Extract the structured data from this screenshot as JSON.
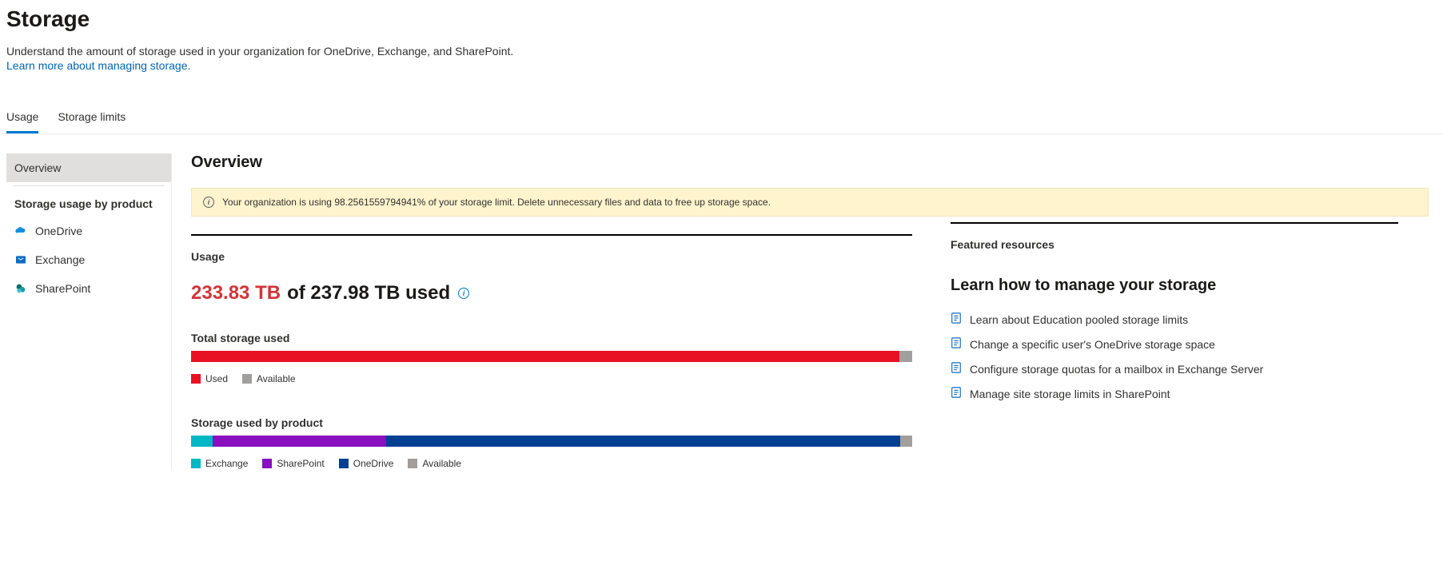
{
  "header": {
    "title": "Storage",
    "description": "Understand the amount of storage used in your organization for OneDrive, Exchange, and SharePoint.",
    "link": "Learn more about managing storage."
  },
  "tabs": {
    "items": [
      "Usage",
      "Storage limits"
    ],
    "active": 0
  },
  "sidebar": {
    "overview": "Overview",
    "section_heading": "Storage usage by product",
    "items": [
      {
        "label": "OneDrive",
        "icon": "onedrive"
      },
      {
        "label": "Exchange",
        "icon": "exchange"
      },
      {
        "label": "SharePoint",
        "icon": "sharepoint"
      }
    ]
  },
  "overview": {
    "heading": "Overview",
    "banner": "Your organization is using 98.2561559794941% of your storage limit. Delete unnecessary files and data to free up storage space.",
    "usage_heading": "Usage",
    "usage_used": "233.83 TB",
    "usage_rest": "of 237.98 TB used",
    "chart1_label": "Total storage used",
    "chart2_label": "Storage used by product"
  },
  "chart_data": [
    {
      "type": "bar",
      "title": "Total storage used",
      "series": [
        {
          "name": "Used",
          "values": [
            98.26
          ],
          "color": "#e81123"
        },
        {
          "name": "Available",
          "values": [
            1.74
          ],
          "color": "#a19f9d"
        }
      ],
      "ylim": [
        0,
        100
      ]
    },
    {
      "type": "bar",
      "title": "Storage used by product",
      "series": [
        {
          "name": "Exchange",
          "values": [
            3.0
          ],
          "color": "#00b7c3"
        },
        {
          "name": "SharePoint",
          "values": [
            24.0
          ],
          "color": "#8a0fbf"
        },
        {
          "name": "OneDrive",
          "values": [
            71.3
          ],
          "color": "#003e92"
        },
        {
          "name": "Available",
          "values": [
            1.7
          ],
          "color": "#a19f9d"
        }
      ],
      "ylim": [
        0,
        100
      ]
    }
  ],
  "resources": {
    "heading": "Featured resources",
    "subheading": "Learn how to manage your storage",
    "links": [
      "Learn about Education pooled storage limits",
      "Change a specific user's OneDrive storage space",
      "Configure storage quotas for a mailbox in Exchange Server",
      "Manage site storage limits in SharePoint"
    ]
  }
}
